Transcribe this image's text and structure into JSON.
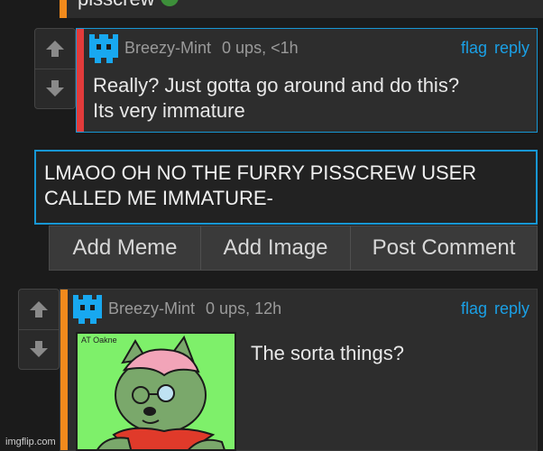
{
  "top_comment": {
    "text": "pisscrew"
  },
  "comment1": {
    "username": "Breezy-Mint",
    "info": "0 ups, <1h",
    "actions": {
      "flag": "flag",
      "reply": "reply"
    },
    "text": "Really? Just gotta go around and do this?\nIts very immature"
  },
  "reply_form": {
    "value": "LMAOO OH NO THE FURRY PISSCREW USER\nCALLED ME IMMATURE-",
    "buttons": {
      "add_meme": "Add Meme",
      "add_image": "Add Image",
      "post_comment": "Post Comment"
    }
  },
  "comment2": {
    "username": "Breezy-Mint",
    "info": "0 ups, 12h",
    "actions": {
      "flag": "flag",
      "reply": "reply"
    },
    "text": "The sorta things?",
    "image_label": "AT Oakne"
  },
  "watermark": "imgflip.com",
  "colors": {
    "accent_blue": "#1797d4",
    "link_blue": "#1aa0e6",
    "side_red": "#e23b3b",
    "side_orange": "#f28a1c",
    "avatar_blue": "#18a8f0"
  }
}
